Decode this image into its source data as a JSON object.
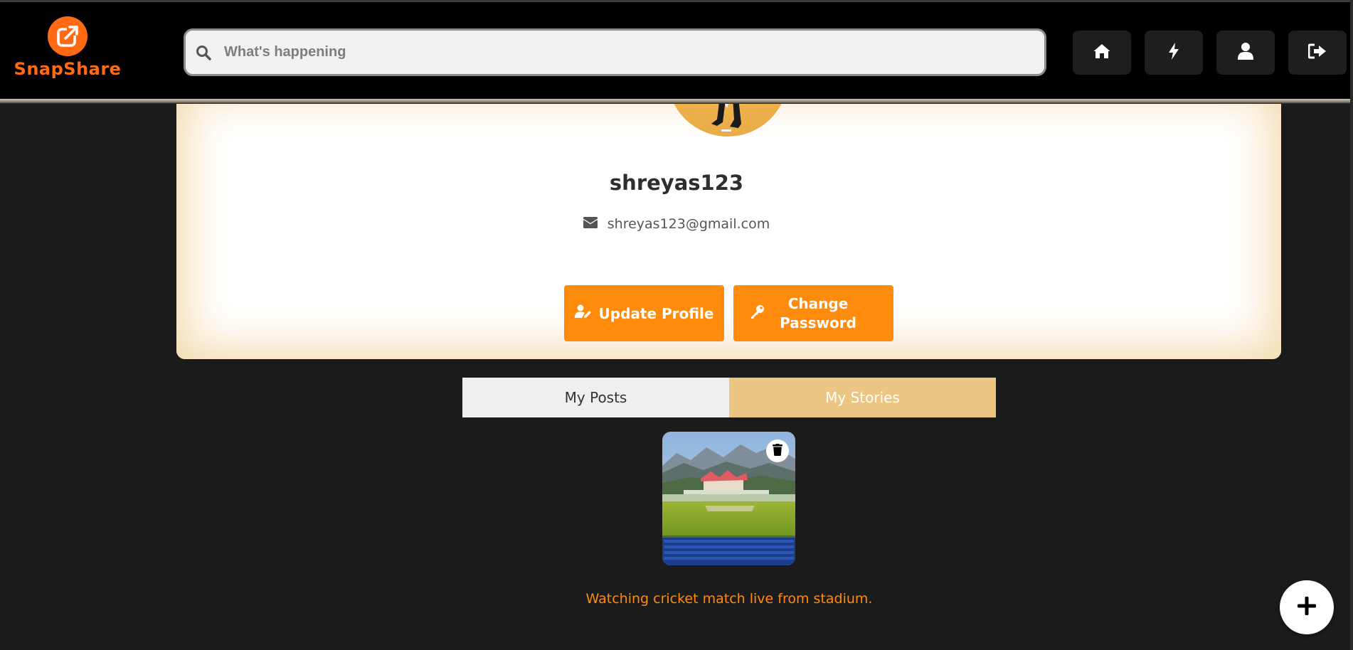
{
  "app": {
    "name": "SnapShare",
    "brand_color": "#ff6a13",
    "accent_color": "#ff8b0c"
  },
  "header": {
    "search": {
      "placeholder": "What's happening",
      "value": "",
      "icon": "search-icon"
    },
    "nav_buttons": [
      {
        "name": "home",
        "icon": "home-icon"
      },
      {
        "name": "stories",
        "icon": "lightning-icon"
      },
      {
        "name": "profile",
        "icon": "user-icon"
      },
      {
        "name": "logout",
        "icon": "sign-out-icon"
      }
    ]
  },
  "profile": {
    "username": "shreyas123",
    "email": "shreyas123@gmail.com",
    "update_label": "Update Profile",
    "change_password_label": "Change Password"
  },
  "tabs": [
    {
      "label": "My Posts",
      "active": false
    },
    {
      "label": "My Stories",
      "active": true
    }
  ],
  "story": {
    "caption": "Watching cricket match live from stadium.",
    "image": "cricket-stadium-mountains"
  },
  "fab": {
    "icon": "plus-icon"
  }
}
